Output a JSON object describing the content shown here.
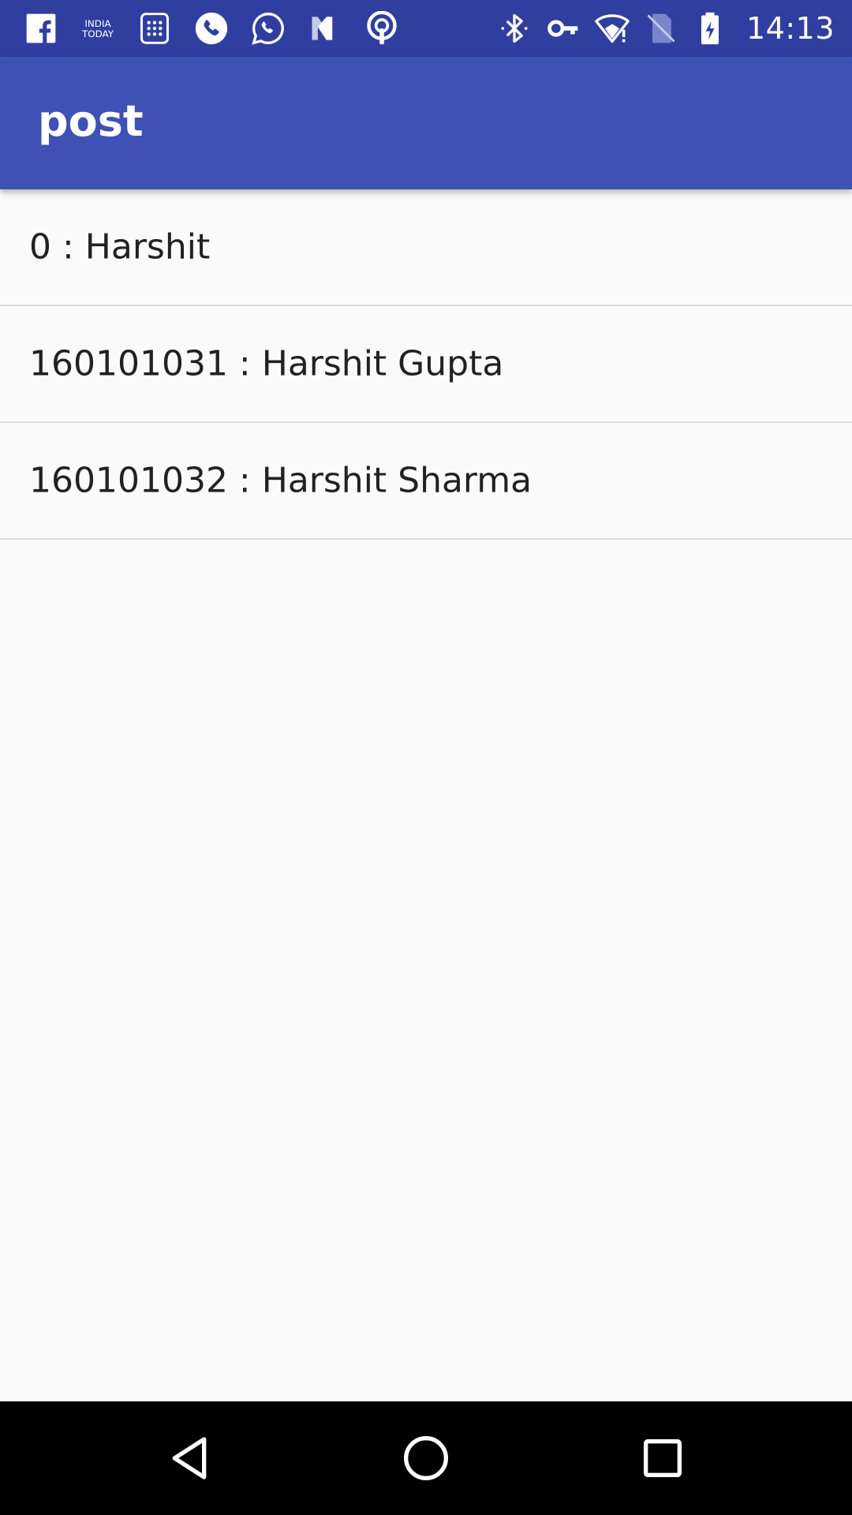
{
  "status_bar": {
    "time": "14:13",
    "notification_icons": [
      "facebook-icon",
      "india-today-icon",
      "calculator-icon",
      "phone-icon",
      "whatsapp-icon",
      "news-icon",
      "hotspot-icon"
    ],
    "system_icons": [
      "bluetooth-icon",
      "vpn-key-icon",
      "wifi-icon",
      "no-sim-icon",
      "battery-charging-icon"
    ],
    "india_today_text": "INDIA TODAY",
    "background_color": "#303f9f"
  },
  "app_bar": {
    "title": "post",
    "background_color": "#3f51b5"
  },
  "list": {
    "items": [
      {
        "label": "0 : Harshit"
      },
      {
        "label": "160101031 : Harshit Gupta"
      },
      {
        "label": "160101032 : Harshit Sharma"
      }
    ]
  },
  "nav_bar": {
    "buttons": [
      "back-icon",
      "home-icon",
      "recents-icon"
    ]
  }
}
